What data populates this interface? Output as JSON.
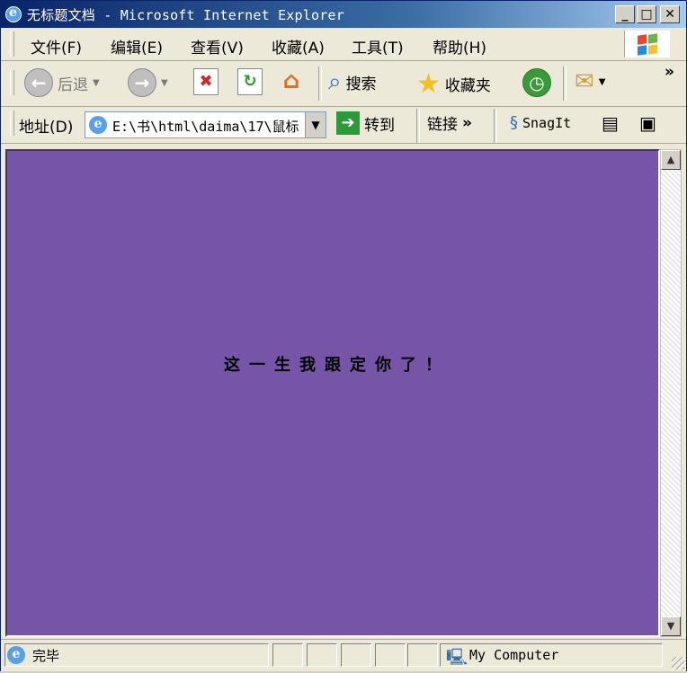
{
  "window": {
    "title": "无标题文档 - Microsoft Internet Explorer",
    "minimize": "_",
    "maximize": "□",
    "close": "✕"
  },
  "menu": [
    "文件(F)",
    "编辑(E)",
    "查看(V)",
    "收藏(A)",
    "工具(T)",
    "帮助(H)"
  ],
  "toolbar": {
    "back_label": "后退",
    "search_label": "搜索",
    "favorites_label": "收藏夹",
    "more": "»"
  },
  "address": {
    "label": "地址(D)",
    "value": "E:\\书\\html\\daima\\17\\鼠标",
    "go_label": "转到",
    "links_label": "链接",
    "links_more": "»",
    "snagit_label": "SnagIt"
  },
  "content": {
    "message": "这一生我跟定你了！",
    "background": "#7655a8"
  },
  "status": {
    "text": "完毕",
    "zone": "My Computer"
  }
}
